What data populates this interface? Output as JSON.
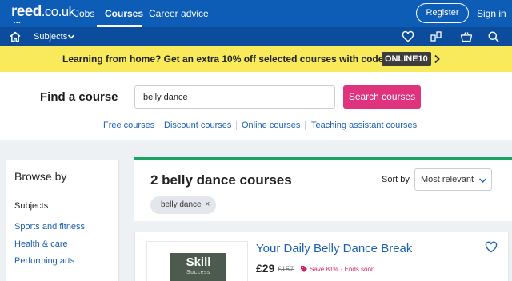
{
  "header": {
    "logo_main": "reed",
    "logo_tld": ".co.uk",
    "logo_dots": "•••",
    "nav": [
      {
        "label": "Jobs"
      },
      {
        "label": "Courses"
      },
      {
        "label": "Career advice"
      }
    ],
    "register_label": "Register",
    "signin_label": "Sign in"
  },
  "subnav": {
    "subjects_label": "Subjects",
    "icons": [
      "home-icon",
      "heart-icon",
      "compare-icon",
      "basket-icon",
      "search-icon"
    ]
  },
  "promo": {
    "text": "Learning from home? Get an extra 10% off selected courses with code",
    "code": "ONLINE10"
  },
  "search": {
    "label": "Find a course",
    "value": "belly dance",
    "button_label": "Search courses",
    "quick_links": [
      "Free courses",
      "Discount courses",
      "Online courses",
      "Teaching assistant courses"
    ]
  },
  "browse": {
    "title": "Browse by",
    "section_label": "Subjects",
    "items": [
      "Sports and fitness",
      "Health & care",
      "Performing arts"
    ]
  },
  "results": {
    "title": "2 belly dance courses",
    "sort_label": "Sort by",
    "sort_value": "Most relevant",
    "filter_chip": "belly dance",
    "filter_chip_remove": "×"
  },
  "courses": [
    {
      "title": "Your Daily Belly Dance Break",
      "price": "£29",
      "old_price": "£157",
      "save_text": "Save 81% - Ends soon",
      "provider_logo_line1": "Skill",
      "provider_logo_line2": "Success"
    }
  ],
  "colors": {
    "brand_blue": "#0d5cb6",
    "subnav_blue": "#0b4d9c",
    "promo_yellow": "#f8ea5b",
    "search_pink": "#e0337e",
    "accent_green": "#19a464",
    "link_blue": "#1a5fb4",
    "save_red": "#d6245b"
  }
}
